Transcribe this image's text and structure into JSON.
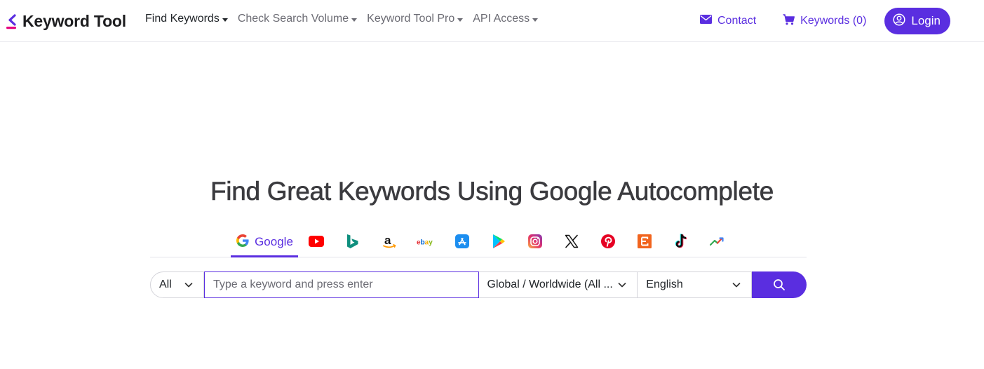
{
  "brand": {
    "name": "Keyword Tool",
    "accent": "#5a2ee0",
    "mark_color": "#e6007e"
  },
  "nav": {
    "left": [
      {
        "label": "Find Keywords",
        "active": true
      },
      {
        "label": "Check Search Volume",
        "active": false
      },
      {
        "label": "Keyword Tool Pro",
        "active": false
      },
      {
        "label": "API Access",
        "active": false
      }
    ],
    "contact": {
      "label": "Contact",
      "icon": "envelope-icon"
    },
    "cart": {
      "label": "Keywords (0)",
      "icon": "cart-icon"
    },
    "login": {
      "label": "Login",
      "icon": "user-circle-icon"
    }
  },
  "hero": {
    "title": "Find Great Keywords Using Google Autocomplete"
  },
  "sources": {
    "active": "Google",
    "items": [
      {
        "name": "Google",
        "icon": "google-icon",
        "label": "Google"
      },
      {
        "name": "YouTube",
        "icon": "youtube-icon"
      },
      {
        "name": "Bing",
        "icon": "bing-icon"
      },
      {
        "name": "Amazon",
        "icon": "amazon-icon"
      },
      {
        "name": "eBay",
        "icon": "ebay-icon"
      },
      {
        "name": "App Store",
        "icon": "app-store-icon"
      },
      {
        "name": "Play Store",
        "icon": "play-store-icon"
      },
      {
        "name": "Instagram",
        "icon": "instagram-icon"
      },
      {
        "name": "X",
        "icon": "x-icon"
      },
      {
        "name": "Pinterest",
        "icon": "pinterest-icon"
      },
      {
        "name": "Etsy",
        "icon": "etsy-icon"
      },
      {
        "name": "TikTok",
        "icon": "tiktok-icon"
      },
      {
        "name": "Trends",
        "icon": "trends-icon"
      }
    ]
  },
  "search": {
    "type_selected": "All",
    "placeholder": "Type a keyword and press enter",
    "value": "",
    "country_selected": "Global / Worldwide (All ...",
    "language_selected": "English",
    "button_icon": "search-icon"
  }
}
